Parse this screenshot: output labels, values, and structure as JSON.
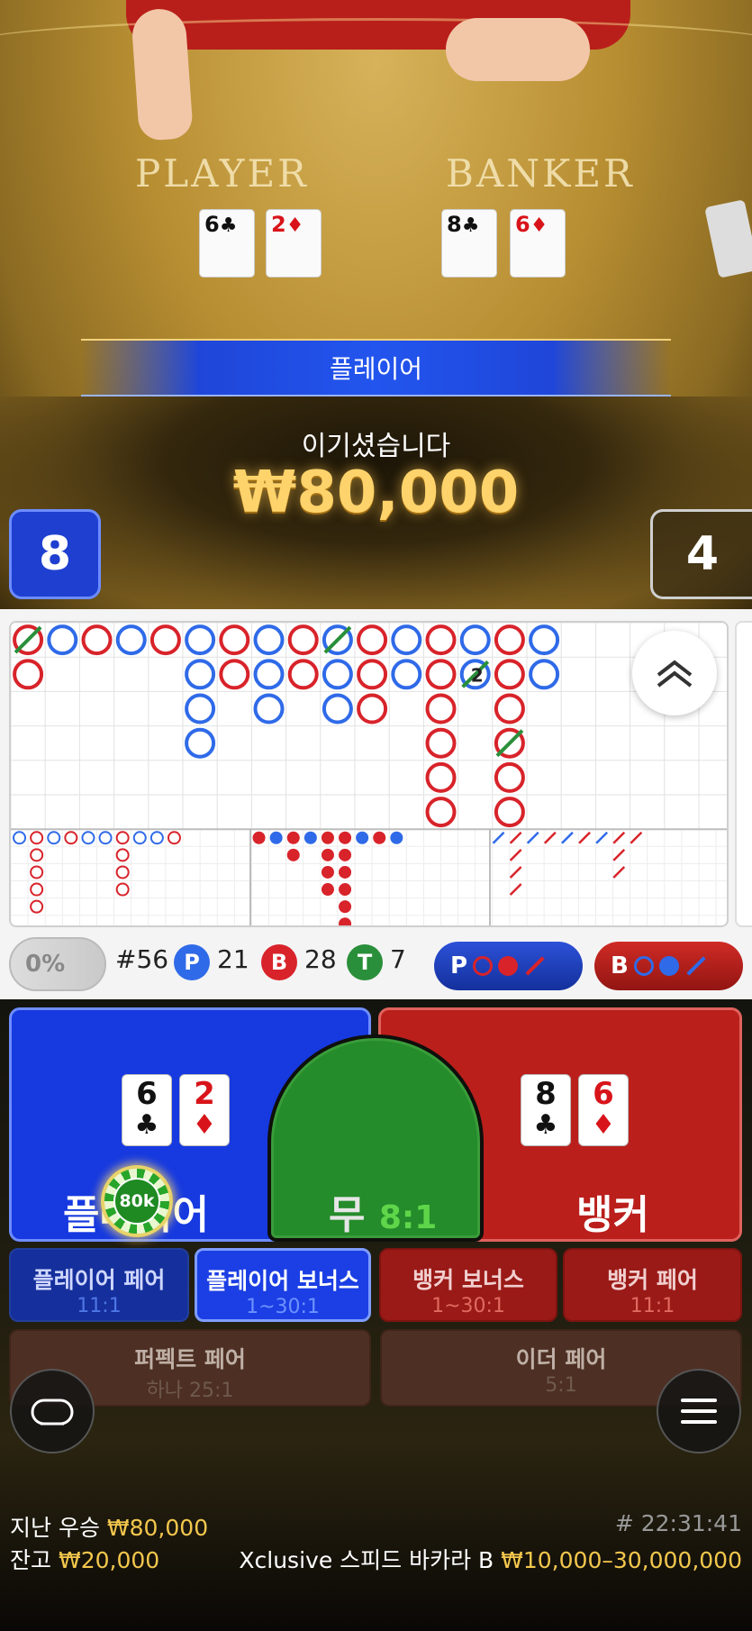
{
  "table": {
    "player_label": "PLAYER",
    "banker_label": "BANKER",
    "player_cards": [
      {
        "rank": "6",
        "suit": "♣",
        "color": "black"
      },
      {
        "rank": "2",
        "suit": "♦",
        "color": "red"
      }
    ],
    "banker_cards": [
      {
        "rank": "8",
        "suit": "♣",
        "color": "black"
      },
      {
        "rank": "6",
        "suit": "♦",
        "color": "red"
      }
    ]
  },
  "result": {
    "winner_label": "플레이어",
    "win_message": "이기셨습니다",
    "win_amount": "₩80,000",
    "player_score": "8",
    "banker_score": "4"
  },
  "roadmap": {
    "player_color": "#2f6ae8",
    "banker_color": "#d8232a",
    "tie_color": "#2a8f3a",
    "pair_marker": "2"
  },
  "stats": {
    "percent": "0%",
    "round": "#56",
    "player_badge": "P",
    "player_count": "21",
    "banker_badge": "B",
    "banker_count": "28",
    "tie_badge": "T",
    "tie_count": "7",
    "predict_player": "P",
    "predict_banker": "B"
  },
  "bets": {
    "player_label": "플레이어",
    "banker_label": "뱅커",
    "tie_label": "무",
    "tie_odds": "8:1",
    "chip_label": "80k",
    "side": [
      {
        "label": "플레이어 페어",
        "odds": "11:1"
      },
      {
        "label": "플레이어 보너스",
        "odds": "1~30:1"
      },
      {
        "label": "뱅커 보너스",
        "odds": "1~30:1"
      },
      {
        "label": "뱅커 페어",
        "odds": "11:1"
      }
    ],
    "perfect_pair": {
      "label": "퍼펙트 페어",
      "odds": "하나 25:1"
    },
    "either_pair": {
      "label": "이더 페어",
      "odds": "5:1"
    }
  },
  "footer": {
    "last_win_label": "지난 우승",
    "last_win_amount": "₩80,000",
    "round_id": "# 22:31:41",
    "balance_label": "잔고",
    "balance_amount": "₩20,000",
    "table_name": "Xclusive 스피드 바카라 B",
    "limits": "₩10,000–30,000,000"
  }
}
